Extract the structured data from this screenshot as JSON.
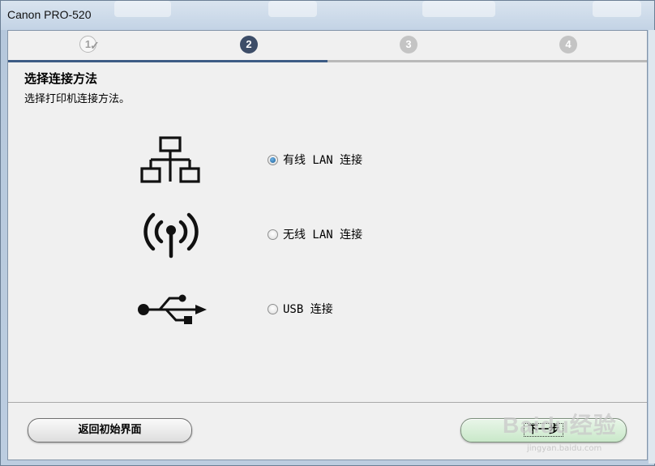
{
  "window": {
    "title": "Canon PRO-520"
  },
  "steps": [
    {
      "label": "1",
      "state": "done"
    },
    {
      "label": "2",
      "state": "active"
    },
    {
      "label": "3",
      "state": "todo"
    },
    {
      "label": "4",
      "state": "todo"
    }
  ],
  "progress": {
    "fraction": 0.5
  },
  "page": {
    "heading": "选择连接方法",
    "subheading": "选择打印机连接方法。"
  },
  "options": [
    {
      "icon": "wired-network-icon",
      "label": "有线 LAN 连接",
      "checked": true
    },
    {
      "icon": "wireless-signal-icon",
      "label": "无线 LAN 连接",
      "checked": false
    },
    {
      "icon": "usb-icon",
      "label": "USB 连接",
      "checked": false
    }
  ],
  "buttons": {
    "back_label": "返回初始界面",
    "next_label": "下一步"
  },
  "watermark": {
    "text": "Baidu经验",
    "url_text": "jingyan.baidu.com"
  },
  "colors": {
    "active_step": "#3d4d68",
    "progress": "#3d5c85",
    "next_button": "#c9e8c9"
  }
}
